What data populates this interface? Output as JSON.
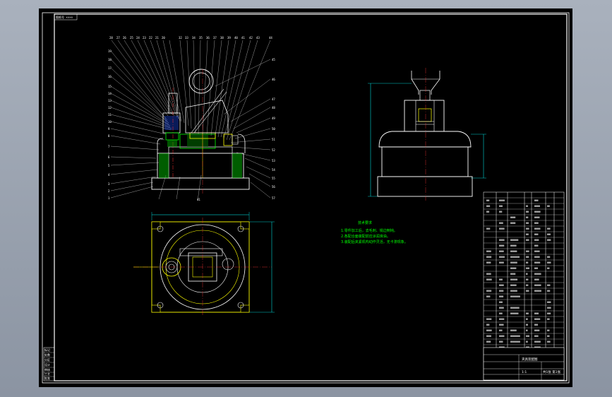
{
  "drawing": {
    "frame_label": "图纸号 ××××",
    "tech_requirements": {
      "title": "技术要求",
      "lines": [
        "1.零件加工后，去毛刺、锐边倒钝。",
        "2.各配合面装配前应涂润滑油。",
        "3.装配后夹紧机构动作灵活，无卡滞现象。"
      ]
    },
    "title_block": {
      "title": "夹具装配图",
      "scale": "1:1",
      "sheet": "共1张 第1张"
    },
    "side_block_labels": [
      "标记",
      "处数",
      "分区",
      "设计",
      "审核",
      "工艺",
      "批准"
    ],
    "colors": {
      "background": "#000000",
      "outline": "#ffffff",
      "dimension": "#00ffff",
      "part_edge": "#ffff00",
      "hatch": "#00ff00",
      "centerline": "#ff3333",
      "leader": "#e0e0e0",
      "note": "#00ff00"
    }
  }
}
